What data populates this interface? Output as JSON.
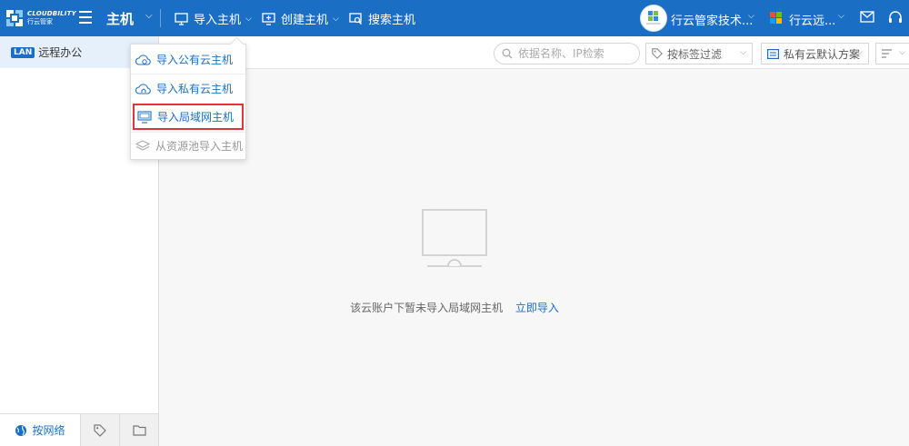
{
  "brand": {
    "name_en": "CLOUDBILITY",
    "name_cn": "行云管家"
  },
  "header": {
    "module_title": "主机",
    "nav": [
      {
        "label": "导入主机",
        "icon": "monitor-import-icon",
        "has_caret": true
      },
      {
        "label": "创建主机",
        "icon": "monitor-plus-icon",
        "has_caret": true
      },
      {
        "label": "搜索主机",
        "icon": "monitor-search-icon",
        "has_caret": false
      }
    ],
    "account_name": "行云管家技术...",
    "tenant_name": "行云远..."
  },
  "colors": {
    "primary": "#1a6fc4",
    "highlight_border": "#e0353c",
    "sidebar_active_bg": "#e6f0fa",
    "content_bg": "#f7f7f7"
  },
  "sidebar": {
    "items": [
      {
        "badge": "LAN",
        "label": "远程办公"
      }
    ],
    "tabs": [
      {
        "label": "按网络",
        "icon": "globe-icon",
        "active": true
      },
      {
        "label": "",
        "icon": "tag-icon",
        "active": false
      },
      {
        "label": "",
        "icon": "folder-icon",
        "active": false
      }
    ]
  },
  "toolbar": {
    "search_placeholder": "依据名称、IP检索",
    "tag_filter_label": "按标签过滤",
    "plan_label": "私有云默认方案"
  },
  "import_menu": {
    "items": [
      {
        "label": "导入公有云主机",
        "icon": "cloud-icon",
        "disabled": false,
        "highlighted": false
      },
      {
        "label": "导入私有云主机",
        "icon": "cloud-home-icon",
        "disabled": false,
        "highlighted": false
      },
      {
        "label": "导入局域网主机",
        "icon": "monitor-icon",
        "disabled": false,
        "highlighted": true
      },
      {
        "label": "从资源池导入主机",
        "icon": "layers-icon",
        "disabled": true,
        "highlighted": false
      }
    ]
  },
  "empty_state": {
    "message": "该云账户下暂未导入局域网主机",
    "action_label": "立即导入"
  }
}
